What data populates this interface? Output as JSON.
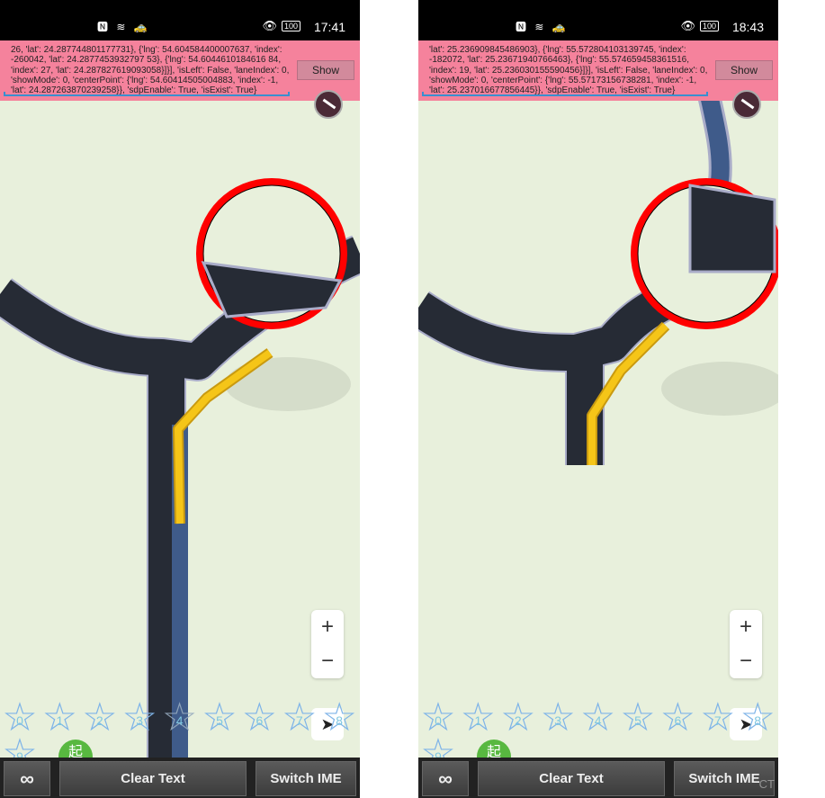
{
  "screens": [
    {
      "status": {
        "left_icons": "🅽 ≋ 🚕",
        "eye": "👁",
        "battery": "100",
        "time": "17:41"
      },
      "debug_text": "26, 'lat': 24.287744801177731}, {'lng': 54.604584400007637, 'index': -260042, 'lat': 24.2877453932797 53}, {'lng': 54.6044610184616 84, 'index': 27, 'lat': 24.287827619093058}]}], 'isLeft': False, 'laneIndex': 0, 'showMode': 0, 'centerPoint': {'lng': 54.60414505004883, 'index': -1, 'lat': 24.287263870239258}}, 'sdpEnable': True, 'isExist': True}",
      "show_label": "Show",
      "highlight_star": "4"
    },
    {
      "status": {
        "left_icons": "🅽 ≋ 🚕",
        "eye": "👁",
        "battery": "100",
        "time": "18:43"
      },
      "debug_text": "'lat': 25.236909845486903}, {'lng': 55.572804103139745, 'index': -182072, 'lat': 25.23671940766463}, {'lng': 55.574659458361516, 'index': 19, 'lat': 25.236030155590456}]}], 'isLeft': False, 'laneIndex': 0, 'showMode': 0, 'centerPoint': {'lng': 55.57173156738281, 'index': -1, 'lat': 25.237016677856445}}, 'sdpEnable': True, 'isExist': True}",
      "show_label": "Show",
      "highlight_star": ""
    }
  ],
  "stars": [
    "0",
    "1",
    "2",
    "3",
    "4",
    "5",
    "6",
    "7",
    "8",
    "9"
  ],
  "zoom_in": "+",
  "zoom_out": "−",
  "start_marker": "起",
  "bottom": {
    "loop_icon": "∞",
    "clear_text": "Clear Text",
    "switch_ime": "Switch IME"
  },
  "watermark": "CT",
  "colors": {
    "debug_bg": "#f5789a",
    "road": "#262b35",
    "road_edge": "#a9acc8",
    "lane": "#3f5b8a",
    "arrow": "#f5c518",
    "map_bg": "#e8f0dc",
    "circle": "#ff0000"
  }
}
